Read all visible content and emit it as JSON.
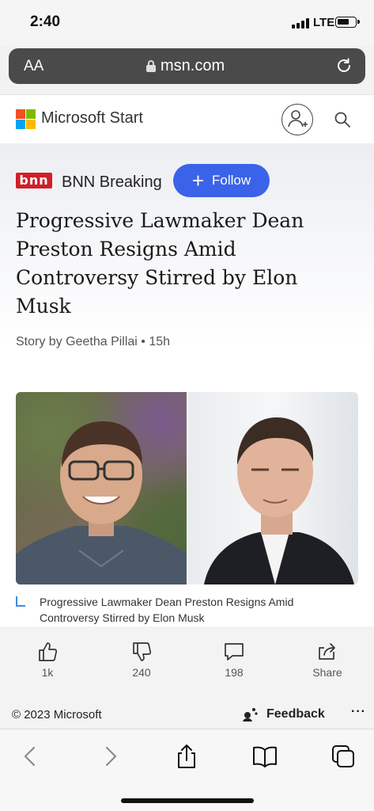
{
  "status_bar": {
    "time": "2:40",
    "network": "LTE"
  },
  "browser": {
    "text_size_label": "AA",
    "url": "msn.com"
  },
  "header": {
    "brand": "Microsoft Start",
    "brand_colors": [
      "#f25022",
      "#7fba00",
      "#00a4ef",
      "#ffb900"
    ]
  },
  "article": {
    "publisher_logo_text": "bnn",
    "publisher": "BNN Breaking",
    "follow_label": "Follow",
    "headline": "Progressive Lawmaker Dean Preston Resigns Amid Controversy Stirred by Elon Musk",
    "byline": "Story by Geetha Pillai • 15h",
    "caption": "Progressive Lawmaker Dean Preston Resigns Amid Controversy Stirred by Elon Musk",
    "accent_color": "#3b63e9"
  },
  "actions": {
    "like_count": "1k",
    "dislike_count": "240",
    "comment_count": "198",
    "share_label": "Share"
  },
  "footer": {
    "copyright": "© 2023 Microsoft",
    "feedback_label": "Feedback",
    "more_label": "···"
  }
}
